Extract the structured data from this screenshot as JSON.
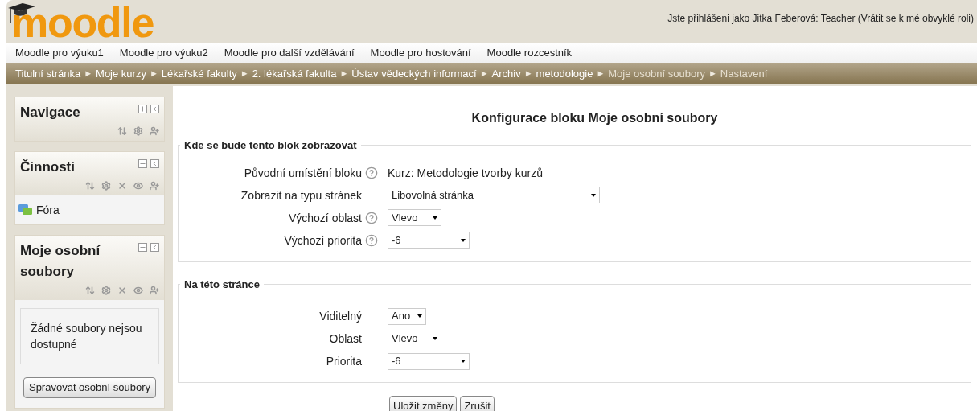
{
  "header": {
    "logo": "moodle",
    "login_info": "Jste přihlášeni jako Jitka Feberová: Teacher (Vrátit se k mé obvyklé roli)"
  },
  "menu": [
    "Moodle pro výuku1",
    "Moodle pro výuku2",
    "Moodle pro další vzdělávání",
    "Moodle pro hostování",
    "Moodle rozcestník"
  ],
  "breadcrumb": [
    {
      "label": "Titulní stránka",
      "disabled": false
    },
    {
      "label": "Moje kurzy",
      "disabled": false
    },
    {
      "label": "Lékařské fakulty",
      "disabled": false
    },
    {
      "label": "2. lékařská fakulta",
      "disabled": false
    },
    {
      "label": "Ústav vědeckých informací",
      "disabled": false
    },
    {
      "label": "Archiv",
      "disabled": false
    },
    {
      "label": "metodologie",
      "disabled": false
    },
    {
      "label": "Moje osobní soubory",
      "disabled": true
    },
    {
      "label": "Nastavení",
      "disabled": true
    }
  ],
  "separator": "►",
  "blocks": [
    {
      "title": "Navigace",
      "expanded": false,
      "actions": [
        {
          "kind": "move"
        },
        {
          "kind": "settings"
        },
        {
          "kind": "assign"
        }
      ]
    },
    {
      "title": "Činnosti",
      "expanded": true,
      "actions": [
        {
          "kind": "move"
        },
        {
          "kind": "settings"
        },
        {
          "kind": "delete"
        },
        {
          "kind": "hide"
        },
        {
          "kind": "assign"
        }
      ],
      "links": [
        "Fóra"
      ]
    },
    {
      "title": "Moje osobní soubory",
      "expanded": true,
      "actions": [
        {
          "kind": "move"
        },
        {
          "kind": "settings"
        },
        {
          "kind": "delete"
        },
        {
          "kind": "hide"
        },
        {
          "kind": "assign"
        }
      ],
      "message": "Žádné soubory nejsou dostupné",
      "button": "Spravovat osobní soubory"
    }
  ],
  "main": {
    "title": "Konfigurace bloku Moje osobní soubory",
    "fieldsets": [
      {
        "legend": "Kde se bude tento blok zobrazovat",
        "fields": [
          {
            "label": "Původní umístění bloku",
            "help": true,
            "kind": "static",
            "value": "Kurz: Metodologie tvorby kurzů"
          },
          {
            "label": "Zobrazit na typu stránek",
            "help": false,
            "kind": "select",
            "value": "Libovolná stránka"
          },
          {
            "label": "Výchozí oblast",
            "help": true,
            "kind": "select",
            "value": "Vlevo"
          },
          {
            "label": "Výchozí priorita",
            "help": true,
            "kind": "select",
            "value": "-6"
          }
        ]
      },
      {
        "legend": "Na této stránce",
        "fields": [
          {
            "label": "Viditelný",
            "help": false,
            "kind": "select",
            "value": "Ano"
          },
          {
            "label": "Oblast",
            "help": false,
            "kind": "select",
            "value": "Vlevo"
          },
          {
            "label": "Priorita",
            "help": false,
            "kind": "select",
            "value": "-6"
          }
        ]
      }
    ],
    "buttons": [
      "Uložit změny",
      "Zrušit"
    ]
  }
}
